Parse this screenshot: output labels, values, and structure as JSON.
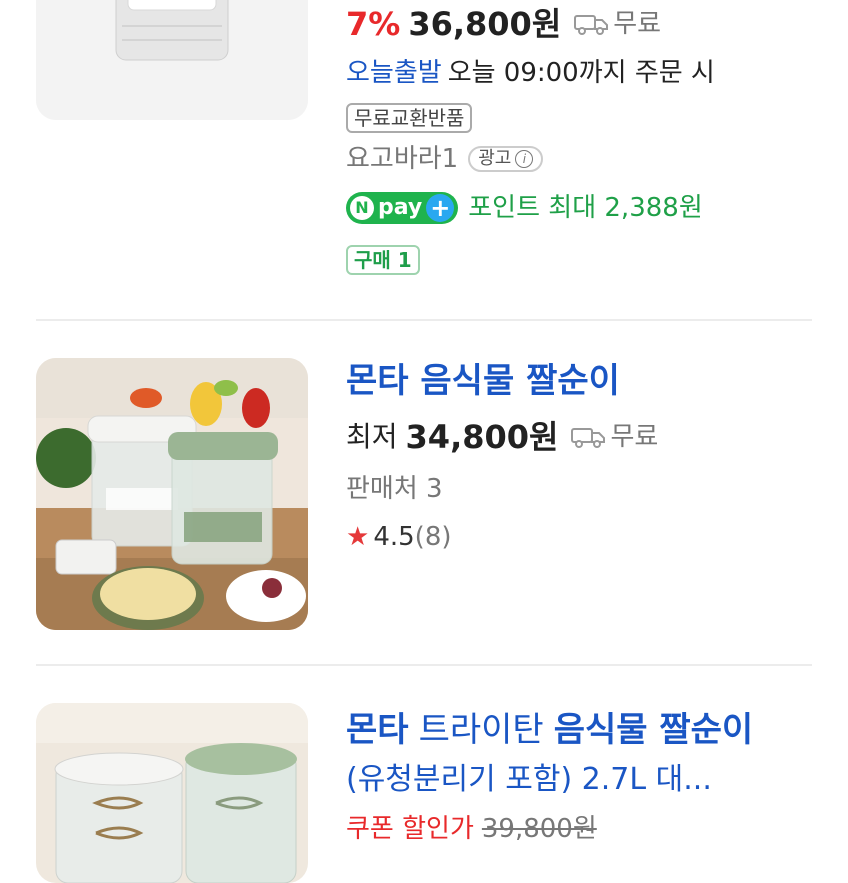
{
  "items": [
    {
      "discount": "7%",
      "price": "36,800원",
      "shipping": "무료",
      "delivery_label": "오늘출발",
      "delivery_text": "오늘 09:00까지 주문 시",
      "exchange_tag": "무료교환반품",
      "seller": "요고바라1",
      "ad_label": "광고",
      "npay_label": "pay",
      "point_text": "포인트 최대 2,388원",
      "purchase_tag": "구매 1"
    },
    {
      "title": "몬타 음식물 짤순이",
      "price_prefix": "최저",
      "price": "34,800원",
      "shipping": "무료",
      "sellers": "판매처 3",
      "rating": "4.5",
      "review_count": "(8)"
    },
    {
      "title_part1": "몬타",
      "title_part2": "트라이탄",
      "title_part3": "음식물 짤순이",
      "title_line2": "(유청분리기 포함) 2.7L 대...",
      "coupon_label": "쿠폰 할인가",
      "original_price": "39,800원"
    }
  ],
  "colors": {
    "accent_blue": "#1a56c4",
    "discount_red": "#e8292b",
    "npay_green": "#1fb34d",
    "star_red": "#e5393a"
  },
  "icons": [
    "truck-icon",
    "info-icon",
    "npay-logo",
    "star-icon"
  ]
}
